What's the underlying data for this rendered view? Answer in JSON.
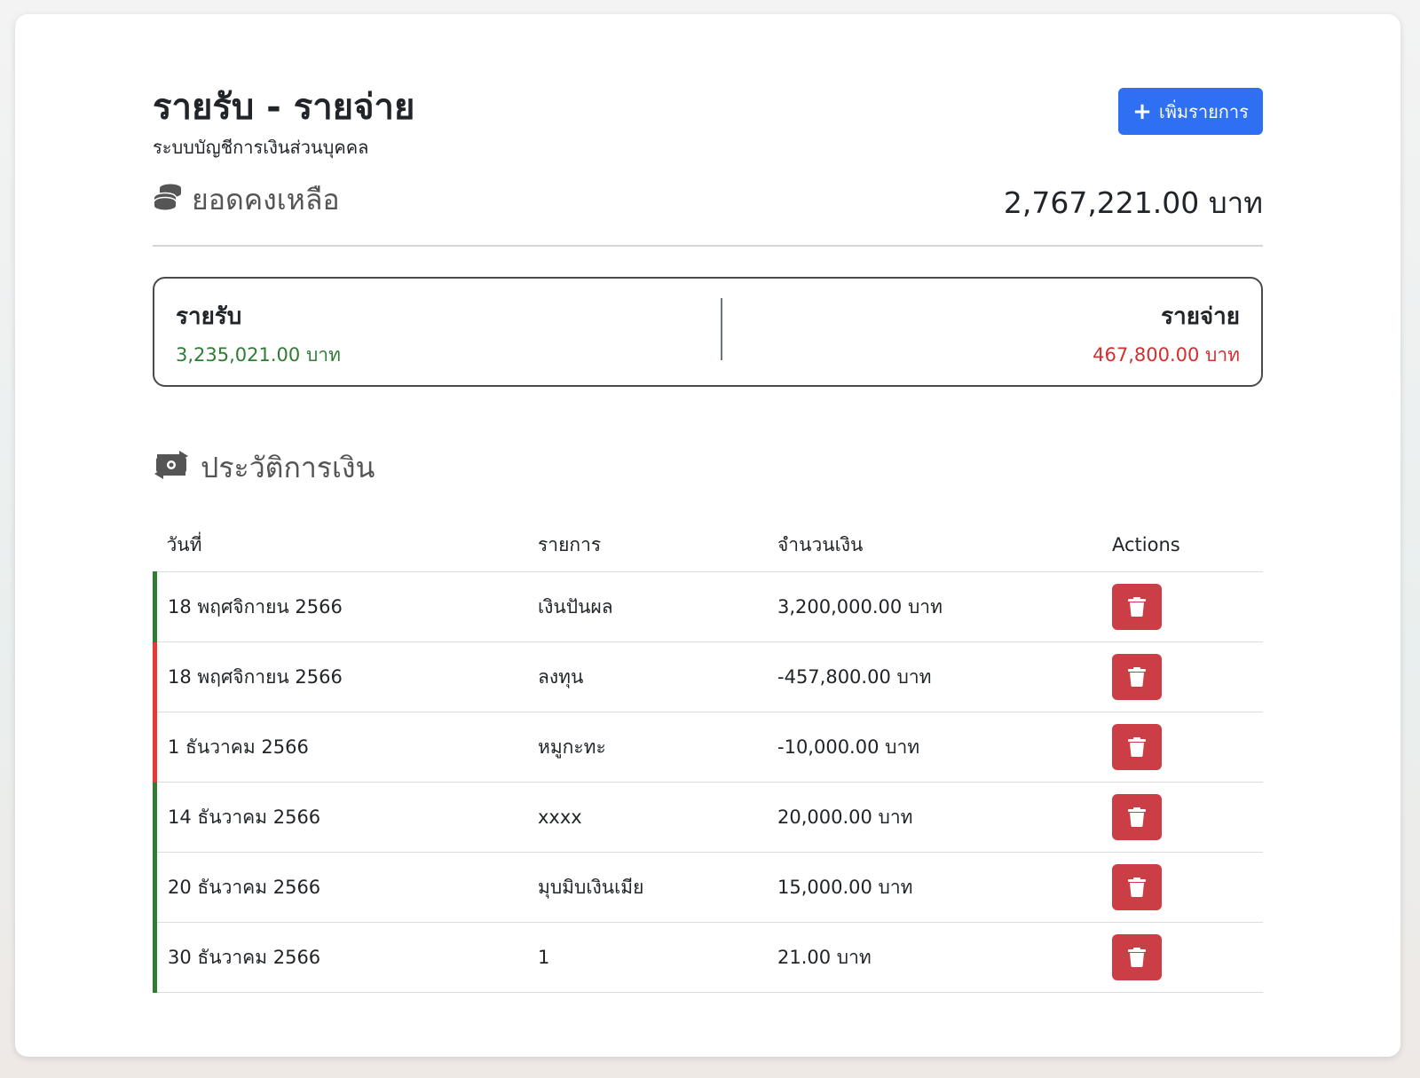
{
  "header": {
    "title": "รายรับ - รายจ่าย",
    "subtitle": "ระบบบัญชีการเงินส่วนบุคคล",
    "add_button_label": "เพิ่มรายการ"
  },
  "balance": {
    "label": "ยอดคงเหลือ",
    "value": "2,767,221.00 บาท",
    "icon": "coins-icon"
  },
  "summary": {
    "income_title": "รายรับ",
    "income_value": "3,235,021.00 บาท",
    "expense_title": "รายจ่าย",
    "expense_value": "467,800.00 บาท"
  },
  "history": {
    "heading": "ประวัติการเงิน",
    "icon": "money-transfer-icon",
    "columns": [
      "วันที่",
      "รายการ",
      "จำนวนเงิน",
      "Actions"
    ],
    "rows": [
      {
        "date": "18 พฤศจิกายน 2566",
        "item": "เงินปันผล",
        "amount": "3,200,000.00 บาท",
        "type": "income"
      },
      {
        "date": "18 พฤศจิกายน 2566",
        "item": "ลงทุน",
        "amount": "-457,800.00 บาท",
        "type": "expense"
      },
      {
        "date": "1 ธันวาคม 2566",
        "item": "หมูกะทะ",
        "amount": "-10,000.00 บาท",
        "type": "expense"
      },
      {
        "date": "14 ธันวาคม 2566",
        "item": "xxxx",
        "amount": "20,000.00 บาท",
        "type": "income"
      },
      {
        "date": "20 ธันวาคม 2566",
        "item": "มุบมิบเงินเมีย",
        "amount": "15,000.00 บาท",
        "type": "income"
      },
      {
        "date": "30 ธันวาคม 2566",
        "item": "1",
        "amount": "21.00 บาท",
        "type": "income"
      }
    ]
  },
  "colors": {
    "primary": "#2f6ff2",
    "income": "#2e7d32",
    "expense": "#d32f2f",
    "danger": "#cc3e45"
  }
}
